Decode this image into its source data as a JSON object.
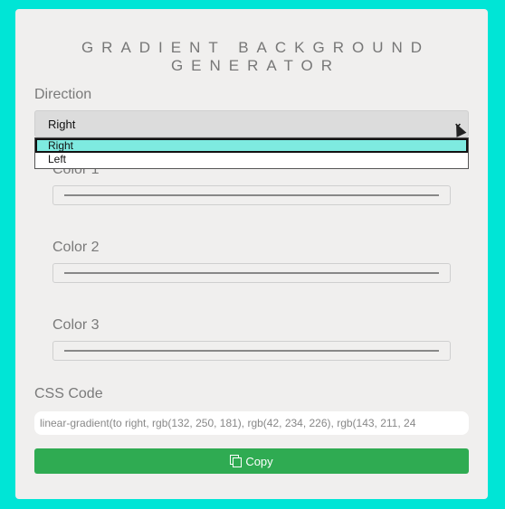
{
  "title": "GRADIENT BACKGROUND GENERATOR",
  "direction": {
    "label": "Direction",
    "selected": "Right",
    "options": [
      "Right",
      "Left"
    ]
  },
  "colors": [
    {
      "label": "Color 1"
    },
    {
      "label": "Color 2"
    },
    {
      "label": "Color 3"
    }
  ],
  "css_code": {
    "label": "CSS Code",
    "value": "linear-gradient(to right, rgb(132, 250, 181), rgb(42, 234, 226), rgb(143, 211, 24"
  },
  "copy_button": {
    "label": "Copy",
    "icon": "copy-icon"
  },
  "theme": {
    "background": "#00e5d6",
    "card": "#f0efee",
    "button": "#2fab52",
    "option_highlight": "#7eeae0"
  }
}
